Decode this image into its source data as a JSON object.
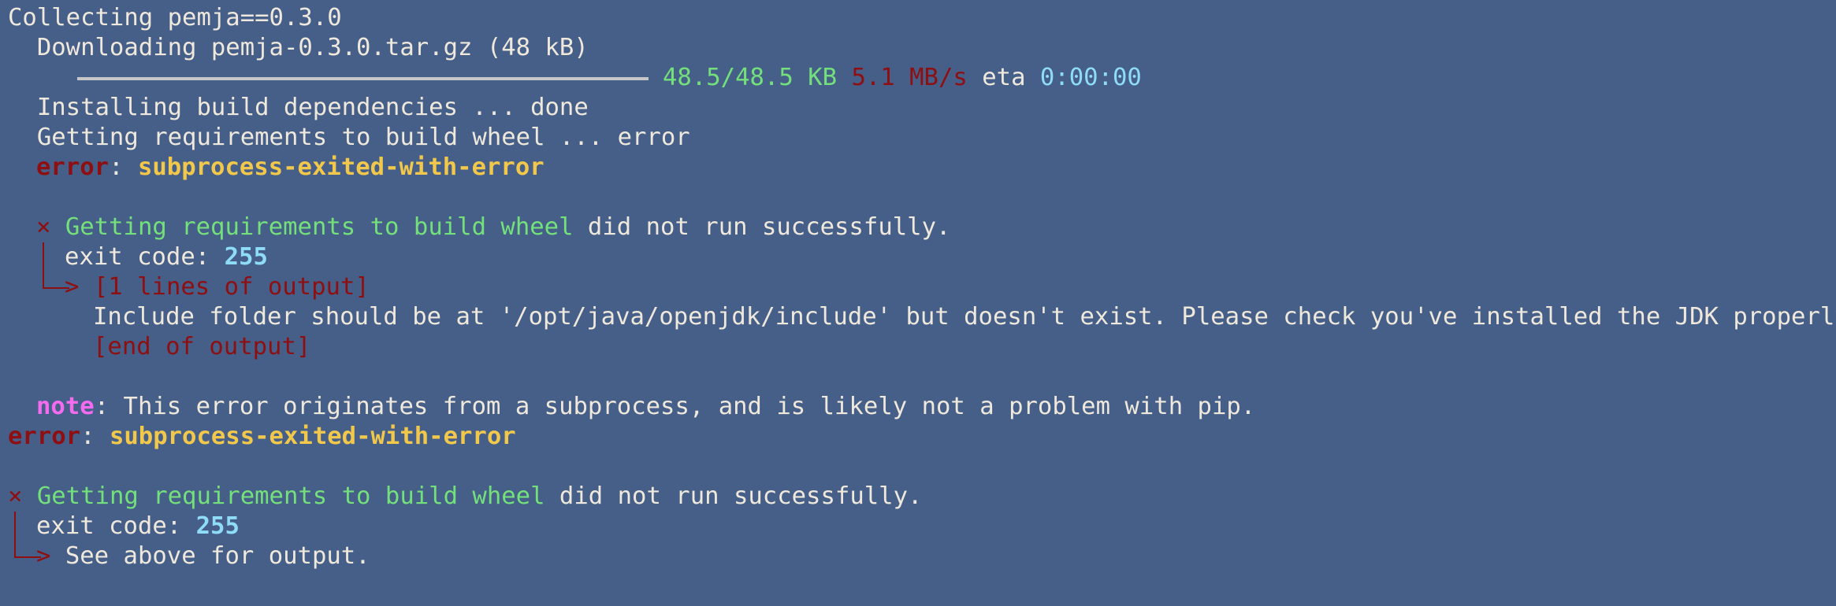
{
  "terminal": {
    "line1": "Collecting pemja==0.3.0",
    "line2": "  Downloading pemja-0.3.0.tar.gz (48 kB)",
    "progress": {
      "fraction": 1.0,
      "size": "48.5/48.5 KB",
      "speed": "5.1 MB/s",
      "eta_label": "eta",
      "eta": "0:00:00"
    },
    "line4": "  Installing build dependencies ... done",
    "line5": "  Getting requirements to build wheel ... error",
    "err1": {
      "label": "error",
      "colon": ":",
      "msg": "subprocess-exited-with-error"
    },
    "block1": {
      "x": "×",
      "getting": "Getting requirements to build wheel",
      "rest": " did not run successfully.",
      "exit_label": "exit code: ",
      "exit_code": "255",
      "lines_of_output": "[1 lines of output]",
      "include": "Include folder should be at '/opt/java/openjdk/include' but doesn't exist. Please check you've installed the JDK properly.",
      "end": "[end of output]"
    },
    "note": {
      "label": "note",
      "msg": ": This error originates from a subprocess, and is likely not a problem with pip."
    },
    "err2": {
      "label": "error",
      "colon": ":",
      "msg": "subprocess-exited-with-error"
    },
    "block2": {
      "x": "×",
      "getting": "Getting requirements to build wheel",
      "rest": " did not run successfully.",
      "exit_label": "exit code: ",
      "exit_code": "255",
      "see": "See above for output."
    },
    "colors": {
      "background": "#465f88",
      "text": "#efe8dc",
      "red": "#8e0f12",
      "yellow": "#f1c84b",
      "green": "#74e07b",
      "cyan": "#8fdcf6",
      "magenta": "#f46bf0"
    }
  }
}
